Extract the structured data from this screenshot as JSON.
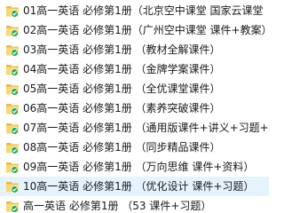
{
  "folders": [
    {
      "label": "01高一英语 必修第1册（北京空中课堂 国家云课堂",
      "synced": true
    },
    {
      "label": "02高一英语 必修第1册（广州空中课堂 课件+教案）",
      "synced": true
    },
    {
      "label": "03高一英语 必修第1册 （教材全解课件）",
      "synced": true
    },
    {
      "label": "04高一英语 必修第1册 （金牌学案课件）",
      "synced": true
    },
    {
      "label": "05高一英语 必修第1册 （全优课堂课件）",
      "synced": true
    },
    {
      "label": "06高一英语 必修第1册 （素养突破课件）",
      "synced": true
    },
    {
      "label": "07高一英语 必修第1册 （通用版课件+讲义+习题+",
      "synced": true
    },
    {
      "label": "08高一英语 必修第1册 （同步精品课件）",
      "synced": true
    },
    {
      "label": "09高一英语 必修第1册 （万向思维 课件+资料）",
      "synced": true
    },
    {
      "label": "10高一英语 必修第1册 （优化设计 课件+习题）",
      "synced": true
    },
    {
      "label": "高一英语 必修第1册 （53 课件+习题）",
      "synced": true
    }
  ],
  "highlighted_index": 9,
  "colors": {
    "folder_back": "#e8b84a",
    "folder_front": "#f8d775",
    "sync_badge": "#2fa84f",
    "highlight": "#e5f3ff"
  }
}
